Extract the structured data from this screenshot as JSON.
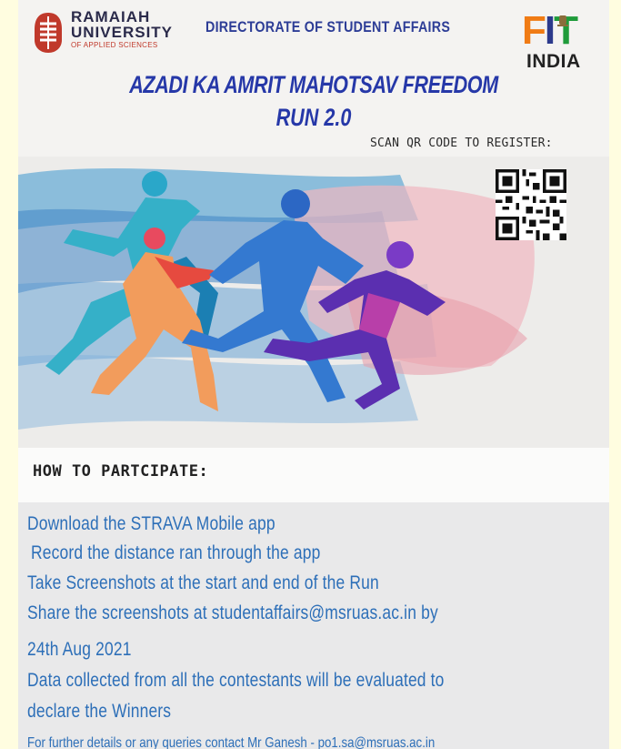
{
  "header": {
    "university_line1": "RAMAIAH",
    "university_line2": "UNIVERSITY",
    "university_line3": "OF APPLIED SCIENCES",
    "directorate": "DIRECTORATE OF STUDENT AFFAIRS",
    "fit_logo": {
      "f": "F",
      "i": "I",
      "t": "T",
      "india": "INDIA"
    }
  },
  "title": {
    "line1": "AZADI KA AMRIT MAHOTSAV FREEDOM",
    "line2": "RUN 2.0"
  },
  "scan_label": "SCAN QR CODE TO REGISTER:",
  "how_heading": "HOW TO PARTCIPATE:",
  "steps": [
    "Download the STRAVA Mobile app",
    "Record the distance ran through the app",
    "Take Screenshots at the start and end of the Run",
    "Share the screenshots at studentaffairs@msruas.ac.in by",
    "24th Aug 2021",
    "Data collected from all the contestants will be evaluated to",
    "declare the Winners"
  ],
  "footer": "For further details or any queries contact  Mr Ganesh -  po1.sa@msruas.ac.in",
  "colors": {
    "title_blue": "#2638a8",
    "step_blue": "#2d6fb8",
    "logo_red": "#c0392b",
    "fit_orange": "#f07b14",
    "fit_green": "#1f9b3a"
  }
}
